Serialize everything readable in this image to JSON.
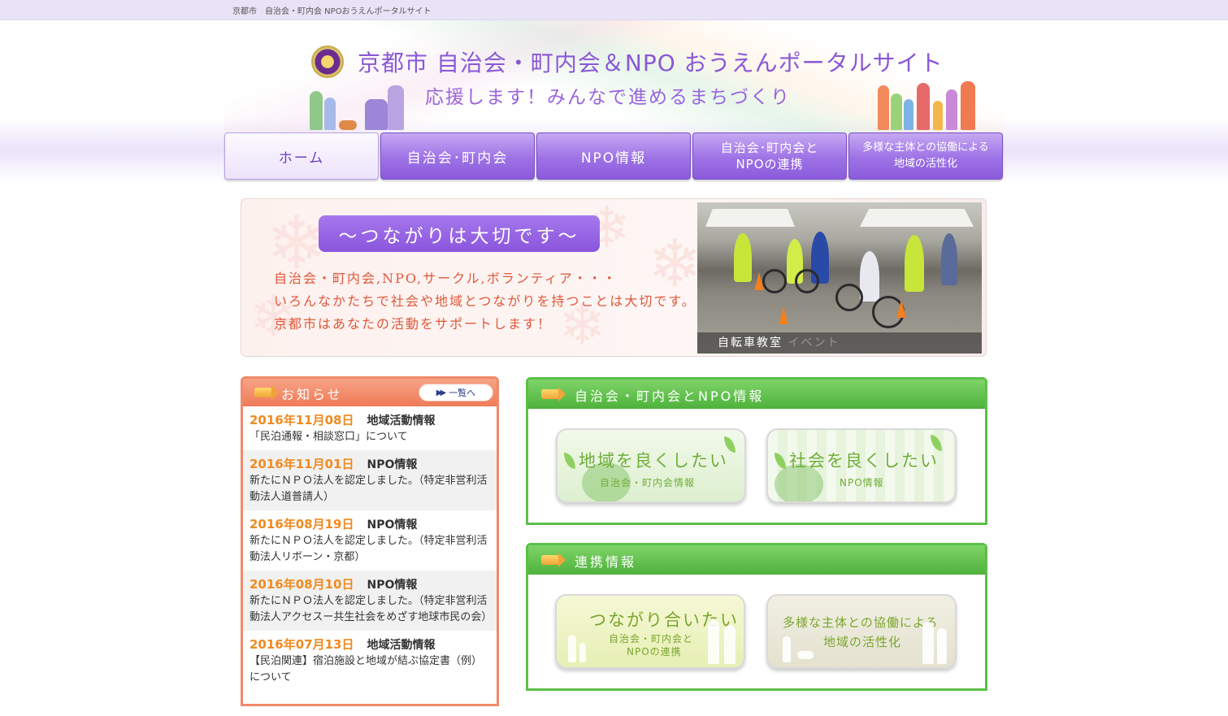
{
  "topbar": {
    "text": "京都市　自治会・町内会 NPOおうえんポータルサイト"
  },
  "header": {
    "title": "京都市  自治会・町内会＆NPO おうえんポータルサイト",
    "subtitle": "応援します！みんなで進めるまちづくり"
  },
  "nav": {
    "home": "ホーム",
    "jichikai": "自治会･町内会",
    "npo": "NPO情報",
    "renkei_1": "自治会･町内会と",
    "renkei_2": "NPOの連携",
    "kyodo_1": "多様な主体との協働による",
    "kyodo_2": "地域の活性化"
  },
  "banner": {
    "pill": "～つながりは大切です～",
    "line1": "自治会・町内会,NPO,サークル,ボランティア・・・",
    "line2": "いろんなかたちで社会や地域とつながりを持つことは大切です。",
    "line3": "京都市はあなたの活動をサポートします！",
    "photo_caption": "自転車教室",
    "photo_caption_faded": "イベント"
  },
  "news": {
    "title": "お知らせ",
    "more_label": "一覧へ",
    "items": [
      {
        "date": "2016年11月08日",
        "category": "地域活動情報",
        "text": "「民泊通報・相談窓口」について"
      },
      {
        "date": "2016年11月01日",
        "category": "NPO情報",
        "text": "新たにＮＰＯ法人を認定しました。（特定非営利活動法人道普請人）"
      },
      {
        "date": "2016年08月19日",
        "category": "NPO情報",
        "text": "新たにＮＰＯ法人を認定しました。（特定非営利活動法人リボーン・京都）"
      },
      {
        "date": "2016年08月10日",
        "category": "NPO情報",
        "text": "新たにＮＰＯ法人を認定しました。（特定非営利活動法人アクセスー共生社会をめざす地球市民の会）"
      },
      {
        "date": "2016年07月13日",
        "category": "地域活動情報",
        "text": "【民泊関連】宿泊施設と地域が結ぶ協定書（例）について"
      }
    ]
  },
  "panel_info": {
    "title": "自治会・町内会とNPO情報",
    "card1_big": "地域を良くしたい",
    "card1_small": "自治会・町内会情報",
    "card2_big": "社会を良くしたい",
    "card2_small": "NPO情報"
  },
  "panel_renkei": {
    "title": "連携情報",
    "card1_big": "つながり合いたい",
    "card1_small1": "自治会・町内会と",
    "card1_small2": "NPOの連携",
    "card2_line1": "多様な主体との協働による",
    "card2_line2": "地域の活性化"
  },
  "colors": {
    "brand_purple": "#8a58d6",
    "news_orange": "#ef7b58",
    "panel_green": "#5cbf4a",
    "date_orange": "#f08a20"
  }
}
